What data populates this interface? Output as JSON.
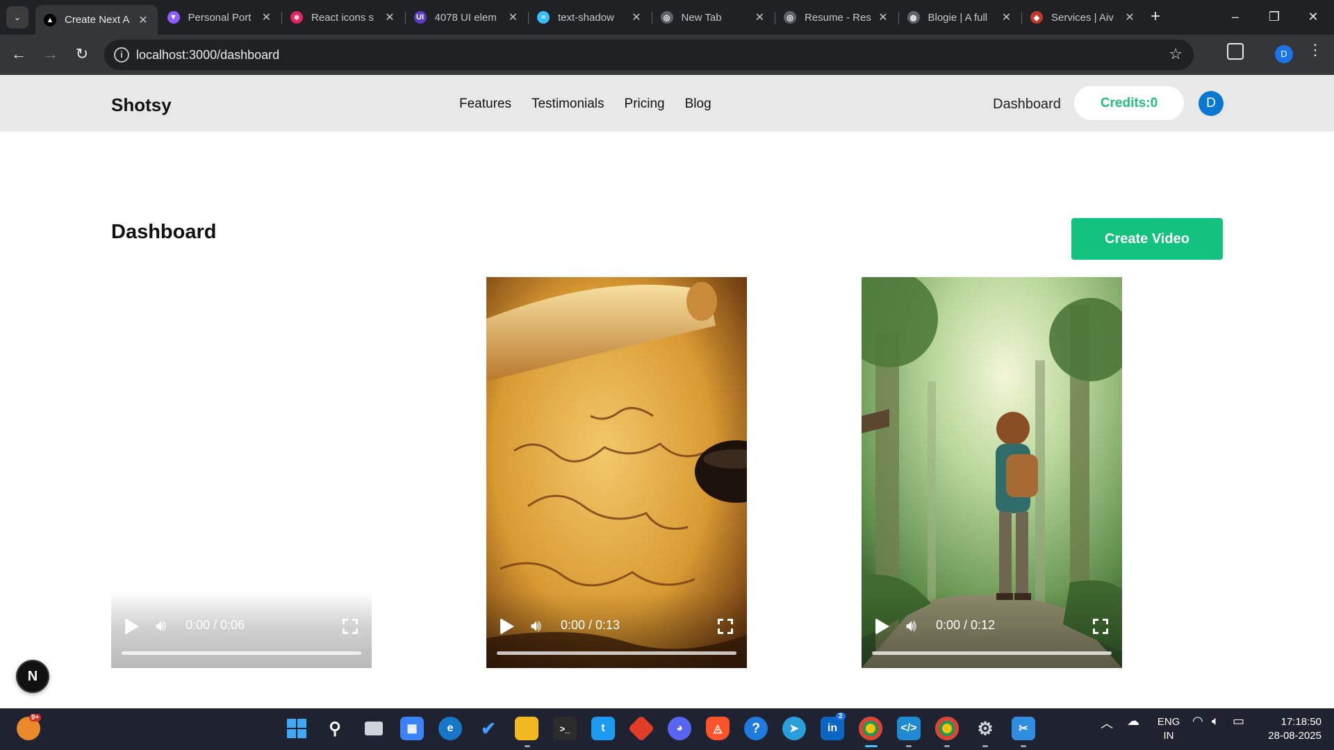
{
  "browser": {
    "tabs": [
      {
        "title": "Create Next A",
        "favicon_color": "#000000",
        "favicon_glyph": "▲",
        "icon": "nextjs-icon",
        "active": true
      },
      {
        "title": "Personal Port",
        "favicon_color": "#8e5cff",
        "favicon_glyph": "▼",
        "icon": "vite-icon",
        "active": false
      },
      {
        "title": "React icons s",
        "favicon_color": "#e0245e",
        "favicon_glyph": "⚛",
        "icon": "react-icon",
        "active": false
      },
      {
        "title": "4078 UI elem",
        "favicon_color": "#5b3cc4",
        "favicon_glyph": "UI",
        "icon": "uiverse-icon",
        "active": false
      },
      {
        "title": "text-shadow",
        "favicon_color": "#38bdf8",
        "favicon_glyph": "≈",
        "icon": "tailwind-icon",
        "active": false
      },
      {
        "title": "New Tab",
        "favicon_color": "#5f6368",
        "favicon_glyph": "◎",
        "icon": "chrome-icon",
        "active": false
      },
      {
        "title": "Resume - Res",
        "favicon_color": "#5f6368",
        "favicon_glyph": "◎",
        "icon": "openai-icon",
        "active": false
      },
      {
        "title": "Blogie | A full",
        "favicon_color": "#5f6368",
        "favicon_glyph": "◍",
        "icon": "globe-icon",
        "active": false
      },
      {
        "title": "Services | Aiv",
        "favicon_color": "#c0392b",
        "favicon_glyph": "◆",
        "icon": "services-icon",
        "active": false
      }
    ],
    "url": "localhost:3000/dashboard",
    "profile_initial": "D"
  },
  "site": {
    "brand": "Shotsy",
    "nav_links": [
      "Features",
      "Testimonials",
      "Pricing",
      "Blog"
    ],
    "dashboard_link": "Dashboard",
    "credits_label": "Credits:0",
    "avatar_initial": "D"
  },
  "main": {
    "title": "Dashboard",
    "create_button": "Create Video",
    "videos": [
      {
        "time": "0:00 / 0:06",
        "scene": "blank",
        "progress": 0
      },
      {
        "time": "0:00 / 0:13",
        "scene": "old-map-scroll-inkwell",
        "progress": 0
      },
      {
        "time": "0:00 / 0:12",
        "scene": "boy-with-backpack-in-forest",
        "progress": 0
      }
    ]
  },
  "floating_badge": "N",
  "taskbar": {
    "weather_badge": "9+",
    "linkedin_badge": "2",
    "lang_line1": "ENG",
    "lang_line2": "IN",
    "time": "17:18:50",
    "date": "28-08-2025"
  }
}
